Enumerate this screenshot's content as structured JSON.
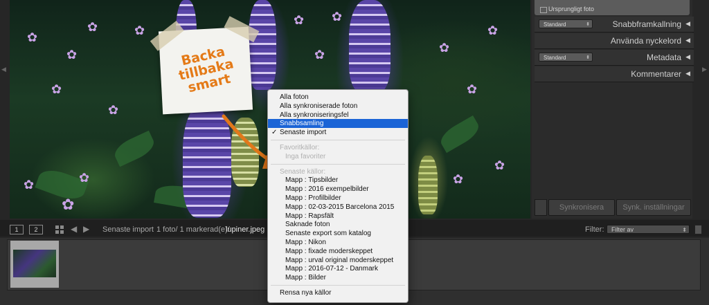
{
  "sticky_note": {
    "line1": "Backa tillbaka",
    "line2": "smart"
  },
  "right_panel": {
    "top_item": "Ursprungligt foto",
    "rows": [
      {
        "select": "Standard",
        "title": "Snabbframkallning"
      },
      {
        "select": "",
        "title": "Använda nyckelord"
      },
      {
        "select": "Standard",
        "title": "Metadata"
      },
      {
        "select": "",
        "title": "Kommentarer"
      }
    ],
    "sync_button": "Synkronisera",
    "sync_settings_button": "Synk. inställningar"
  },
  "filmstrip_bar": {
    "monitor1": "1",
    "monitor2": "2",
    "source": "Senaste import",
    "count": "1 foto/ 1 markerad(e)/",
    "filename": "lupiner.jpeg",
    "filter_label": "Filter:",
    "filter_value": "Filter av"
  },
  "menu": {
    "group1": [
      "Alla foton",
      "Alla synkroniserade foton",
      "Alla synkroniseringsfel",
      "Snabbsamling",
      "Senaste import"
    ],
    "highlighted_index": 3,
    "checked_index": 4,
    "favorites_header": "Favoritkällor:",
    "no_favorites": "Inga favoriter",
    "recent_header": "Senaste källor:",
    "recent_sources": [
      "Mapp : Tipsbilder",
      "Mapp : 2016 exempelbilder",
      "Mapp : Profilbilder",
      "Mapp : 02-03-2015 Barcelona 2015",
      "Mapp : Rapsfält",
      "Saknade foton",
      "Senaste export som katalog",
      "Mapp : Nikon",
      "Mapp : fixade moderskeppet",
      "Mapp : urval original moderskeppet",
      "Mapp : 2016-07-12 - Danmark",
      "Mapp : Bilder"
    ],
    "clear_label": "Rensa nya källor"
  },
  "colors": {
    "accent": "#1b64d6",
    "note_text": "#e47a17",
    "arrow": "#e2781a"
  }
}
